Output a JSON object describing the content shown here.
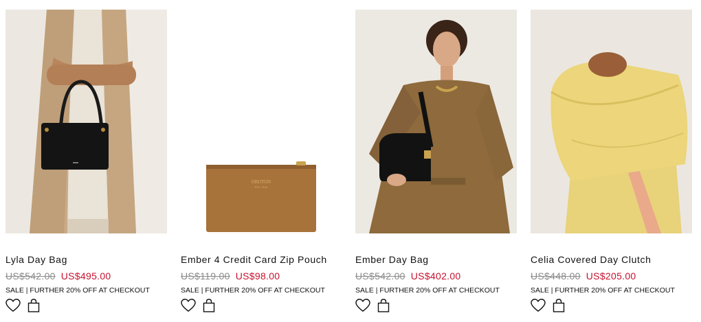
{
  "products": [
    {
      "name": "Lyla Day Bag",
      "old_price": "US$542.00",
      "sale_price": "US$495.00",
      "promo": "SALE | FURTHER 20% OFF AT CHECKOUT"
    },
    {
      "name": "Ember 4 Credit Card Zip Pouch",
      "old_price": "US$119.00",
      "sale_price": "US$98.00",
      "promo": "SALE | FURTHER 20% OFF AT CHECKOUT",
      "image_text": [
        "OROTON",
        "EST. 1938"
      ]
    },
    {
      "name": "Ember Day Bag",
      "old_price": "US$542.00",
      "sale_price": "US$402.00",
      "promo": "SALE | FURTHER 20% OFF AT CHECKOUT"
    },
    {
      "name": "Celia Covered Day Clutch",
      "old_price": "US$448.00",
      "sale_price": "US$205.00",
      "promo": "SALE | FURTHER 20% OFF AT CHECKOUT"
    }
  ],
  "icons": {
    "wishlist": "heart-icon",
    "bag": "shopping-bag-icon"
  },
  "colors": {
    "sale": "#c8102e",
    "strike": "#8a8a8a",
    "text": "#111111"
  }
}
